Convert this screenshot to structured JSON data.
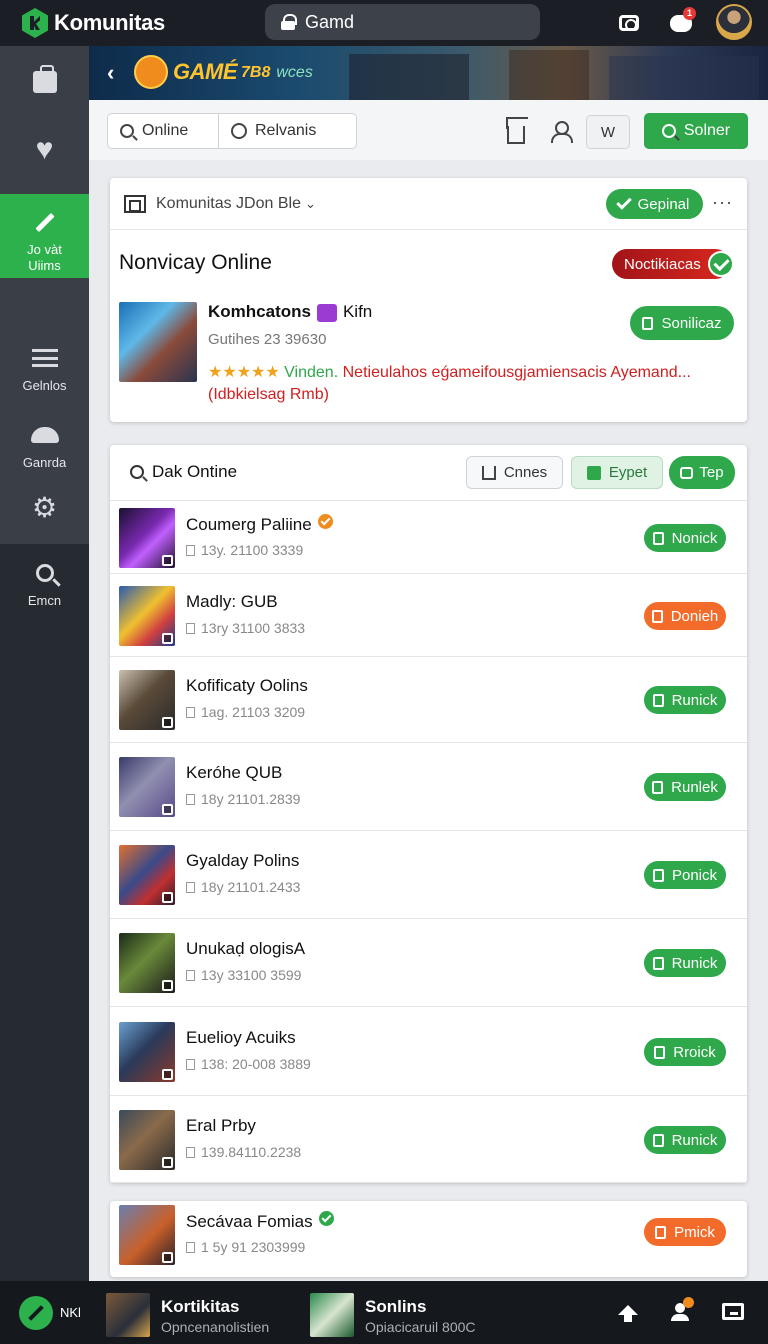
{
  "app": {
    "title": "Komunitas"
  },
  "search": {
    "value": "Gamd"
  },
  "colors": {
    "brand": "#2db14c",
    "orange": "#f26b2a",
    "danger": "#d02020",
    "dark": "#1b1e24"
  },
  "top_icons": [
    "camera-icon",
    "chat-icon",
    "avatar"
  ],
  "notif_count": "1",
  "sidebar": {
    "items": [
      {
        "icon": "bag-icon",
        "label": ""
      },
      {
        "icon": "heart-icon",
        "label": ""
      },
      {
        "icon": "pencil-icon",
        "label": "Jo vàt Uiims",
        "active": true
      },
      {
        "icon": "menu-icon",
        "label": "Gelnlos"
      },
      {
        "icon": "cloud-icon",
        "label": "Ganrda"
      },
      {
        "icon": "gear-icon",
        "label": ""
      },
      {
        "icon": "search-icon",
        "label": "Emcn"
      }
    ],
    "item3_line1": "Jo vàt",
    "item3_line2": "Uiims"
  },
  "banner": {
    "title": "GAMÉ",
    "title_accent": "7B8",
    "subtitle": "wces"
  },
  "toolbar": {
    "tab_online": "Online",
    "tab_relevant": "Relvanis",
    "w_label": "W",
    "action_label": "Solner"
  },
  "featured": {
    "header_label": "Komunitas JDon Ble",
    "header_badge": "Gepinal",
    "title": "Nonvicay Online",
    "notif_label": "Noctikiacas",
    "item_name": "Komhcatons",
    "item_tag": "Kifn",
    "item_sub": "Gutihes 23 39630",
    "stars": "★★★★★",
    "verified_word": "Vinden.",
    "description": "Netieulahos eǵameifousgjamiensacis Ayemand...",
    "note": "(Idbkielsag Rmb)",
    "action_label": "Sonilicaz"
  },
  "list": {
    "title": "Dak Ontine",
    "btn_share": "Cnnes",
    "btn_export": "Eypet",
    "btn_top": "Tep",
    "rows": [
      {
        "title": "Coumerg Paliine",
        "sub": "13y. 21100 3339",
        "button": "Nonick",
        "button_color": "green",
        "verified": true,
        "verified_color": "#f08b1d"
      },
      {
        "title": "Madly: GUB",
        "sub": "13ry 31100 3833",
        "button": "Donieh",
        "button_color": "orange",
        "verified": false
      },
      {
        "title": "Kofificaty Oolins",
        "sub": "1ag. 21103 3209",
        "button": "Runick",
        "button_color": "green",
        "verified": false
      },
      {
        "title": "Keróhe QUB",
        "sub": "18y 21101.2839",
        "button": "Runlek",
        "button_color": "green",
        "verified": false
      },
      {
        "title": "Gyalday Polins",
        "sub": "18y 21101.2433",
        "button": "Ponick",
        "button_color": "green",
        "verified": false
      },
      {
        "title": "Unukaḍ ologisA",
        "sub": "13y 33100 3599",
        "button": "Runick",
        "button_color": "green",
        "verified": false
      },
      {
        "title": "Euelioy Acuiks",
        "sub": "138: 20-008 3889",
        "button": "Rroick",
        "button_color": "green",
        "verified": false
      },
      {
        "title": "Eral Prby",
        "sub": "139.84110.2238",
        "button": "Runick",
        "button_color": "green",
        "verified": false
      }
    ]
  },
  "extra_row": {
    "title": "Secávaa Fomias",
    "sub": "1 5y 91 2303999",
    "button": "Pmick",
    "button_color": "orange",
    "verified": true,
    "verified_color": "#2ea84a"
  },
  "bottombar": {
    "logo_label": "NKl",
    "item1_title": "Kortikitas",
    "item1_sub": "Opncenanolistien",
    "item2_title": "Sonlins",
    "item2_sub": "Opiacicaruil 800C",
    "badge": ""
  }
}
